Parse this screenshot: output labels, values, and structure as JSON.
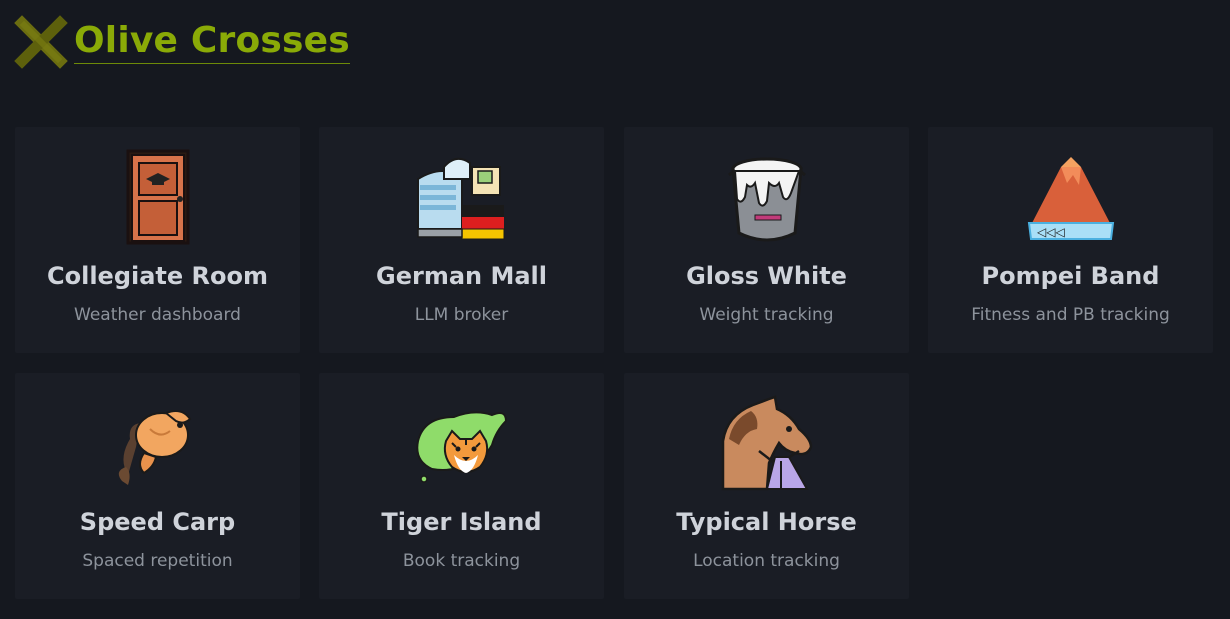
{
  "site": {
    "title": "Olive Crosses",
    "logo_icon": "olive-cross-logo",
    "accent_color": "#8aaa07"
  },
  "cards": [
    {
      "title": "Collegiate Room",
      "subtitle": "Weather dashboard",
      "icon": "door-icon"
    },
    {
      "title": "German Mall",
      "subtitle": "LLM broker",
      "icon": "mall-icon"
    },
    {
      "title": "Gloss White",
      "subtitle": "Weight tracking",
      "icon": "paint-bucket-icon"
    },
    {
      "title": "Pompei Band",
      "subtitle": "Fitness and PB tracking",
      "icon": "volcano-icon"
    },
    {
      "title": "Speed Carp",
      "subtitle": "Spaced repetition",
      "icon": "fish-icon"
    },
    {
      "title": "Tiger Island",
      "subtitle": "Book tracking",
      "icon": "tiger-island-icon"
    },
    {
      "title": "Typical Horse",
      "subtitle": "Location tracking",
      "icon": "horse-icon"
    }
  ]
}
